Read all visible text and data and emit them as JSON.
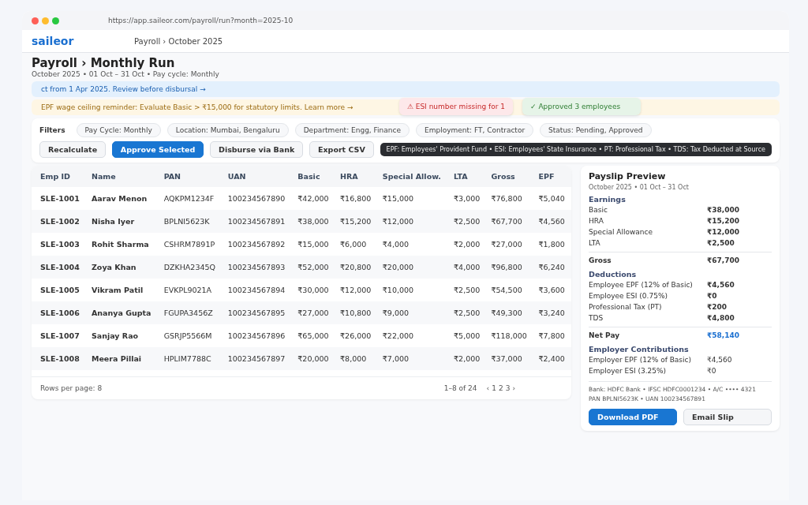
{
  "browser": {
    "url": "https://app.saileor.com/payroll/run?month=2025-10"
  },
  "header": {
    "logo": "saileor",
    "breadcrumb": "Payroll › October 2025"
  },
  "page": {
    "title": "Payroll › Monthly Run",
    "subtitle": "October 2025 • 01 Oct – 31 Oct • Pay cycle: Monthly"
  },
  "banners": [
    {
      "kind": "info",
      "text": "ct from 1 Apr 2025. Review before disbursal →"
    },
    {
      "kind": "warning",
      "text": "EPF wage ceiling reminder: Evaluate Basic > ₹15,000 for statutory limits. Learn more →"
    }
  ],
  "toasts": [
    {
      "kind": "error",
      "text": "⚠ ESI number missing for 1"
    },
    {
      "kind": "success",
      "text": "✓ Approved 3 employees"
    }
  ],
  "filters": {
    "label": "Filters",
    "chips": [
      "Pay Cycle: Monthly",
      "Location: Mumbai, Bengaluru",
      "Department: Engg, Finance",
      "Employment: FT, Contractor",
      "Status: Pending, Approved"
    ]
  },
  "actions": [
    {
      "label": "Recalculate",
      "primary": false
    },
    {
      "label": "Approve Selected",
      "primary": true
    },
    {
      "label": "Disburse via Bank",
      "primary": false
    },
    {
      "label": "Export CSV",
      "primary": false
    }
  ],
  "tooltip": "EPF: Employees' Provident Fund • ESI: Employees' State Insurance • PT: Professional Tax • TDS: Tax Deducted at Source",
  "table": {
    "columns": [
      "Emp ID",
      "Name",
      "PAN",
      "UAN",
      "Basic",
      "HRA",
      "Special Allow.",
      "LTA",
      "Gross",
      "EPF"
    ],
    "rows": [
      [
        "SLE-1001",
        "Aarav Menon",
        "AQKPM1234F",
        "100234567890",
        "₹42,000",
        "₹16,800",
        "₹15,000",
        "₹3,000",
        "₹76,800",
        "₹5,040"
      ],
      [
        "SLE-1002",
        "Nisha Iyer",
        "BPLNI5623K",
        "100234567891",
        "₹38,000",
        "₹15,200",
        "₹12,000",
        "₹2,500",
        "₹67,700",
        "₹4,560"
      ],
      [
        "SLE-1003",
        "Rohit Sharma",
        "CSHRM7891P",
        "100234567892",
        "₹15,000",
        "₹6,000",
        "₹4,000",
        "₹2,000",
        "₹27,000",
        "₹1,800"
      ],
      [
        "SLE-1004",
        "Zoya Khan",
        "DZKHA2345Q",
        "100234567893",
        "₹52,000",
        "₹20,800",
        "₹20,000",
        "₹4,000",
        "₹96,800",
        "₹6,240"
      ],
      [
        "SLE-1005",
        "Vikram Patil",
        "EVKPL9021A",
        "100234567894",
        "₹30,000",
        "₹12,000",
        "₹10,000",
        "₹2,500",
        "₹54,500",
        "₹3,600"
      ],
      [
        "SLE-1006",
        "Ananya Gupta",
        "FGUPA3456Z",
        "100234567895",
        "₹27,000",
        "₹10,800",
        "₹9,000",
        "₹2,500",
        "₹49,300",
        "₹3,240"
      ],
      [
        "SLE-1007",
        "Sanjay Rao",
        "GSRJP5566M",
        "100234567896",
        "₹65,000",
        "₹26,000",
        "₹22,000",
        "₹5,000",
        "₹118,000",
        "₹7,800"
      ],
      [
        "SLE-1008",
        "Meera Pillai",
        "HPLIM7788C",
        "100234567897",
        "₹20,000",
        "₹8,000",
        "₹7,000",
        "₹2,000",
        "₹37,000",
        "₹2,400"
      ]
    ],
    "rows_per_page": "Rows per page: 8",
    "range": "1–8 of 24",
    "pager": [
      "‹",
      "1",
      "2",
      "3",
      "›"
    ]
  },
  "payslip": {
    "title": "Payslip Preview",
    "period": "October 2025 • 01 Oct – 31 Oct",
    "sections": [
      {
        "heading": "Earnings",
        "bold_values": true,
        "rows": [
          {
            "label": "Basic",
            "value": "₹38,000"
          },
          {
            "label": "HRA",
            "value": "₹15,200"
          },
          {
            "label": "Special Allowance",
            "value": "₹12,000"
          },
          {
            "label": "LTA",
            "value": "₹2,500"
          }
        ],
        "total": {
          "kind": "gross",
          "label": "Gross",
          "value": "₹67,700"
        }
      },
      {
        "heading": "Deductions",
        "bold_values": true,
        "rows": [
          {
            "label": "Employee EPF (12% of Basic)",
            "value": "₹4,560"
          },
          {
            "label": "Employee ESI (0.75%)",
            "value": "₹0"
          },
          {
            "label": "Professional Tax (PT)",
            "value": "₹200"
          },
          {
            "label": "TDS",
            "value": "₹4,800"
          }
        ],
        "total": {
          "kind": "net",
          "label": "Net Pay",
          "value": "₹58,140"
        }
      },
      {
        "heading": "Employer Contributions",
        "bold_values": false,
        "rows": [
          {
            "label": "Employer EPF (12% of Basic)",
            "value": "₹4,560"
          },
          {
            "label": "Employer ESI (3.25%)",
            "value": "₹0"
          }
        ]
      }
    ],
    "bank": [
      "Bank: HDFC Bank • IFSC HDFC0001234 • A/C •••• 4321",
      "PAN BPLNI5623K • UAN 100234567891"
    ],
    "buttons": [
      {
        "label": "Download PDF",
        "primary": true
      },
      {
        "label": "Email Slip",
        "primary": false
      }
    ]
  }
}
